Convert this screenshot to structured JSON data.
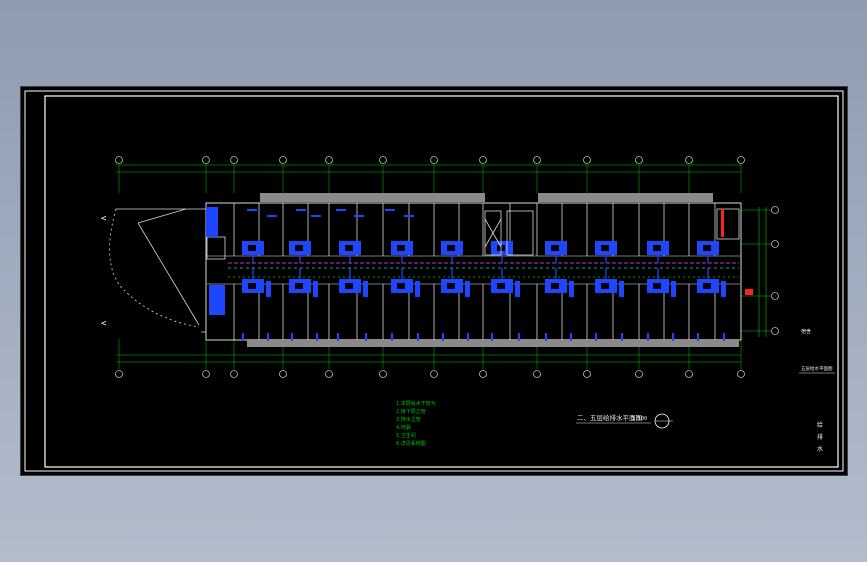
{
  "colors": {
    "background": "#000000",
    "frame": "#ffffff",
    "dimension": "#00c800",
    "wall": "#d8d8d8",
    "fixture": "#1e46ff",
    "pipe_main": "#ff40ff",
    "pipe_secondary": "#00d8d8",
    "accent_red": "#ff2020",
    "title_text": "#e8e8e8"
  },
  "drawing": {
    "plan_title": "二、五层给排水平面图",
    "plan_scale": "1:100",
    "room_label": "宿舍",
    "side_caption": "五层给水平面图",
    "title_block_glyphs": [
      "给",
      "排",
      "水"
    ]
  },
  "notes": {
    "lines": [
      "1.本层给水干管为",
      "2.接下层立管",
      "3.排水立管",
      "4.地漏",
      "5.卫生间",
      "6.详见系统图"
    ]
  },
  "icons": [
    "north-arrow-icon"
  ]
}
